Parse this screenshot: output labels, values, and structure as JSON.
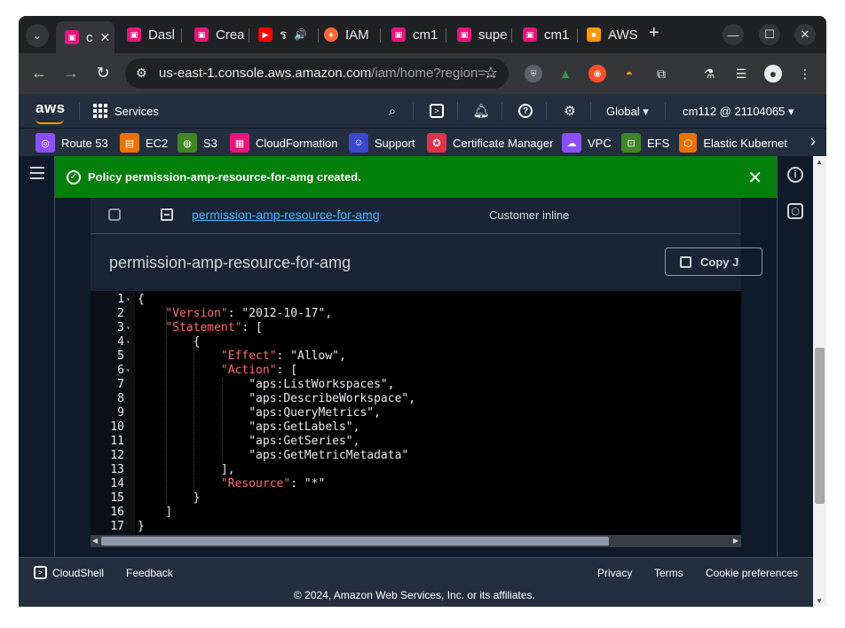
{
  "browser": {
    "tabs": [
      {
        "label": "c",
        "favicon_color": "#e7157b",
        "favicon_glyph": "aws-icon"
      },
      {
        "label": "Dasl",
        "favicon_color": "#e7157b",
        "favicon_glyph": "aws-icon"
      },
      {
        "label": "Crea",
        "favicon_color": "#e7157b",
        "favicon_glyph": "aws-icon"
      },
      {
        "label": "ร",
        "favicon_color": "#ff0000",
        "favicon_glyph": "youtube-icon"
      },
      {
        "label": "IAM",
        "favicon_color": "#ff6b35",
        "favicon_glyph": "iam-icon"
      },
      {
        "label": "cm1",
        "favicon_color": "#e7157b",
        "favicon_glyph": "aws-icon"
      },
      {
        "label": "supe",
        "favicon_color": "#e7157b",
        "favicon_glyph": "aws-icon"
      },
      {
        "label": "cm1",
        "favicon_color": "#e7157b",
        "favicon_glyph": "aws-icon"
      },
      {
        "label": "AWS",
        "favicon_color": "#ff9900",
        "favicon_glyph": "box-icon"
      }
    ],
    "url_host": "us-east-1.console.aws.amazon.com",
    "url_rest": "/iam/home?region=..."
  },
  "aws_header": {
    "logo": "aws",
    "services_label": "Services",
    "region_label": "Global",
    "account_label": "cm112 @ 21104065"
  },
  "favorites": [
    {
      "label": "Route 53",
      "color": "#8c4fff"
    },
    {
      "label": "EC2",
      "color": "#ed7100"
    },
    {
      "label": "S3",
      "color": "#3f8624"
    },
    {
      "label": "CloudFormation",
      "color": "#e7157b"
    },
    {
      "label": "Support",
      "color": "#3b48cc"
    },
    {
      "label": "Certificate Manager",
      "color": "#dd344c"
    },
    {
      "label": "VPC",
      "color": "#8c4fff"
    },
    {
      "label": "EFS",
      "color": "#3f8624"
    },
    {
      "label": "Elastic Kubernet",
      "color": "#ed7100"
    }
  ],
  "flash": {
    "message": "Policy permission-amp-resource-for-amg created."
  },
  "policy_row": {
    "name": "permission-amp-resource-for-amg",
    "type": "Customer inline"
  },
  "policy_detail": {
    "title": "permission-amp-resource-for-amg",
    "copy_label": "Copy J"
  },
  "editor": {
    "lines": [
      "{",
      "    \"Version\": \"2012-10-17\",",
      "    \"Statement\": [",
      "        {",
      "            \"Effect\": \"Allow\",",
      "            \"Action\": [",
      "                \"aps:ListWorkspaces\",",
      "                \"aps:DescribeWorkspace\",",
      "                \"aps:QueryMetrics\",",
      "                \"aps:GetLabels\",",
      "                \"aps:GetSeries\",",
      "                \"aps:GetMetricMetadata\"",
      "            ],",
      "            \"Resource\": \"*\"",
      "        }",
      "    ]",
      "}"
    ],
    "foldable_lines": [
      1,
      3,
      4,
      6
    ]
  },
  "footer": {
    "cloudshell_label": "CloudShell",
    "feedback_label": "Feedback",
    "privacy_label": "Privacy",
    "terms_label": "Terms",
    "cookie_label": "Cookie preferences",
    "copyright": "© 2024, Amazon Web Services, Inc. or its affiliates."
  }
}
